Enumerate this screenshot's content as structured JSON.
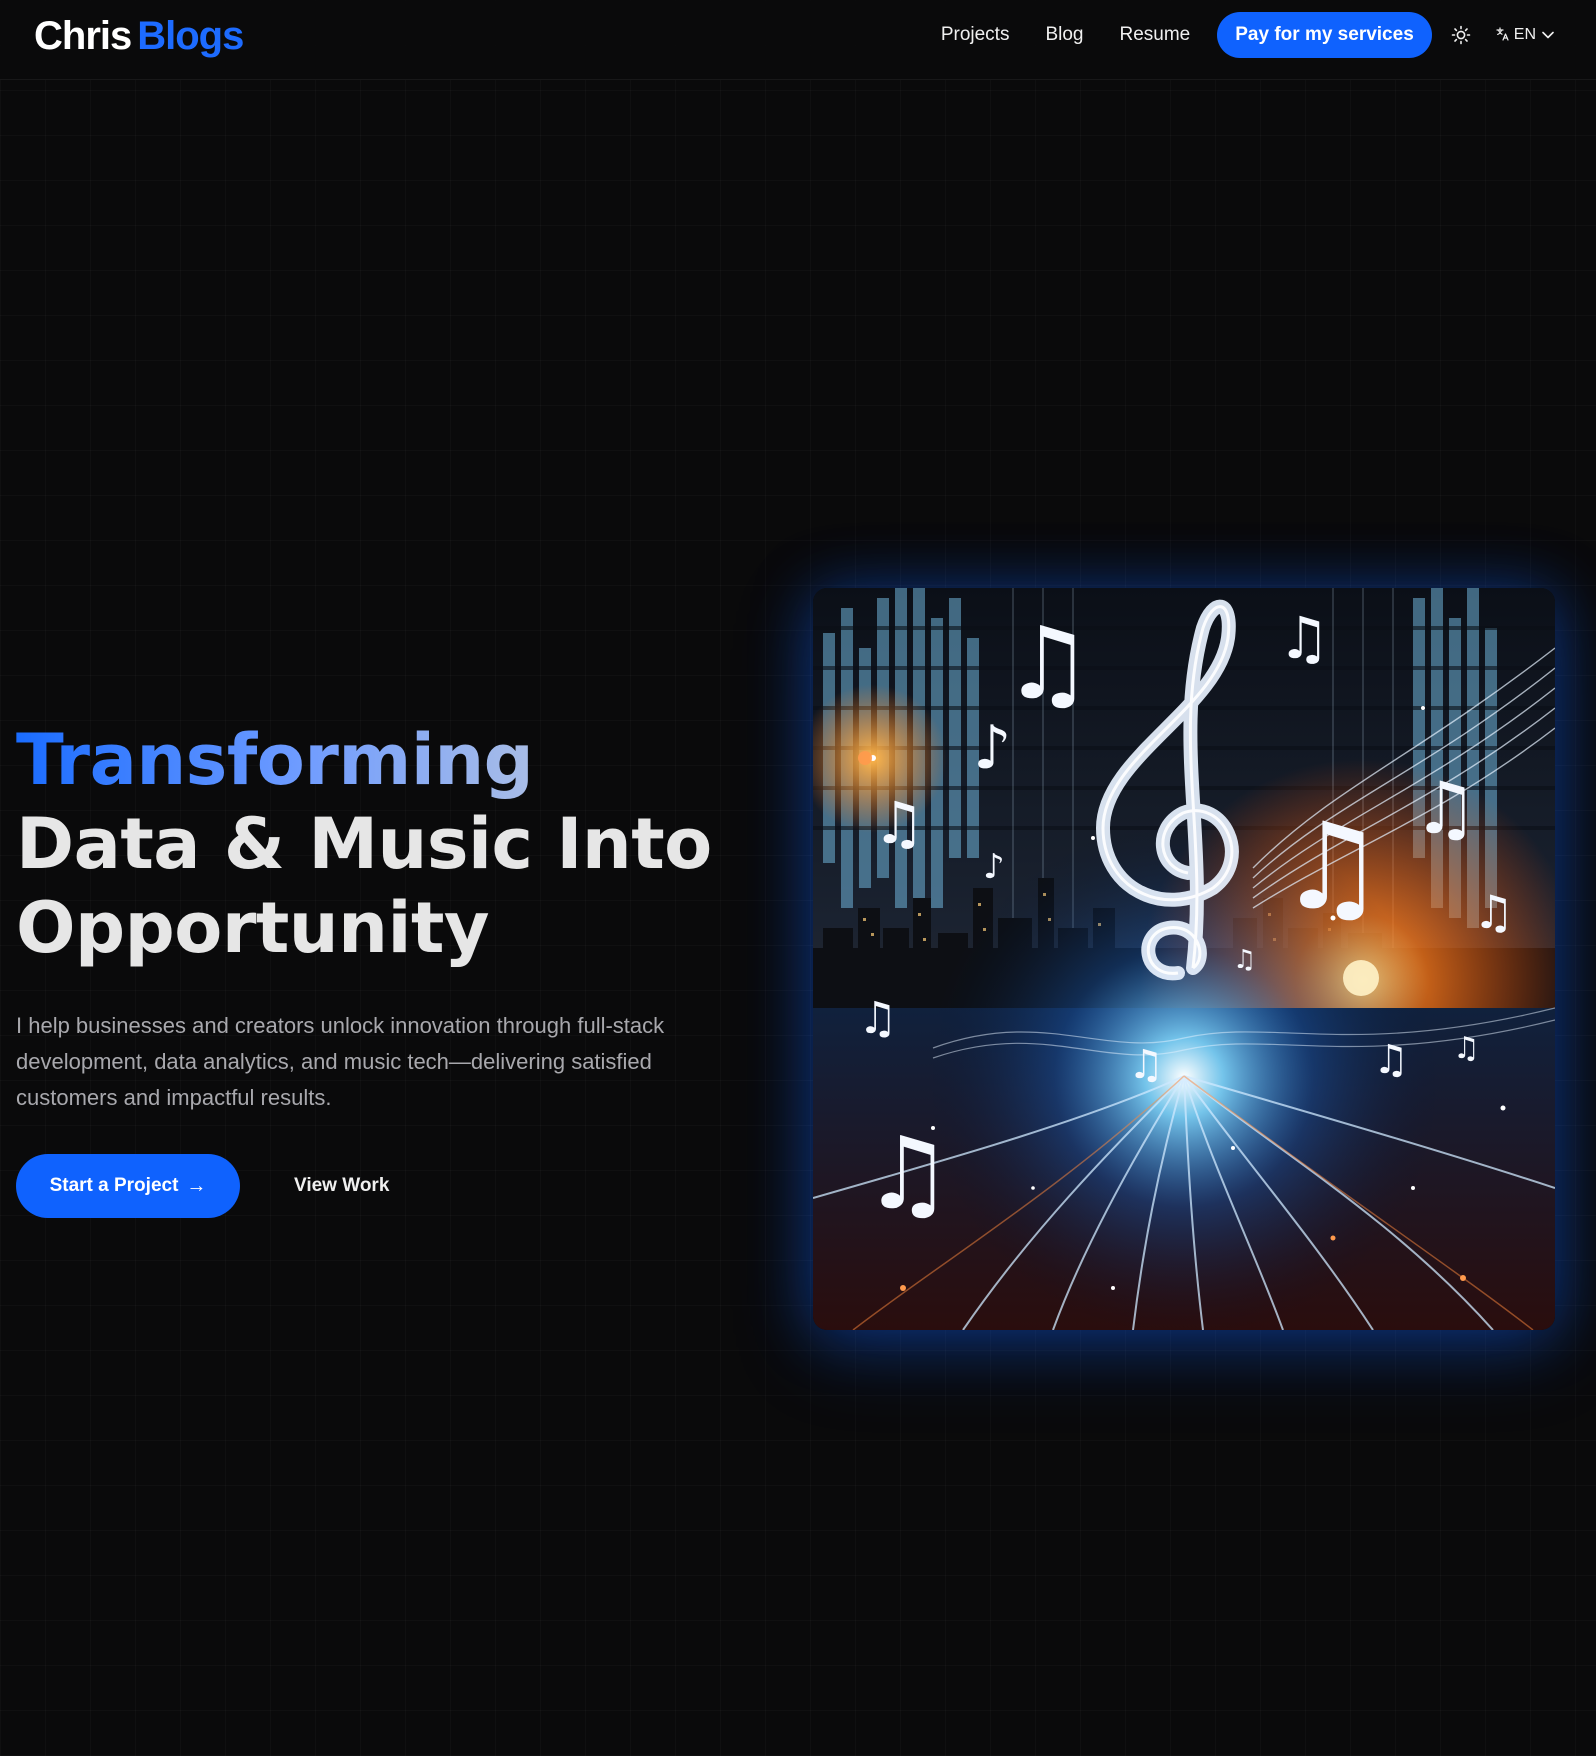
{
  "brand": {
    "first": "Chris",
    "second": "Blogs"
  },
  "nav": {
    "items": [
      "Projects",
      "Blog",
      "Resume"
    ],
    "cta_label": "Pay for my services",
    "theme_icon": "sun-icon",
    "language": "EN"
  },
  "hero": {
    "title_accent": "Transforming",
    "title_line2": "Data & Music Into",
    "title_line3": "Opportunity",
    "subtitle": "I help businesses and creators unlock innovation through full-stack development, data analytics, and music tech—delivering satisfied customers and impactful results.",
    "primary_cta": "Start a Project",
    "secondary_cta": "View Work"
  },
  "colors": {
    "background": "#0a0a0b",
    "accent": "#0f62fe",
    "brand_blue": "#1d6bff"
  }
}
